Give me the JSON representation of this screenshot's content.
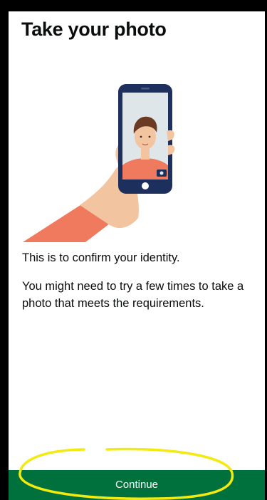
{
  "page": {
    "title": "Take your photo",
    "paragraph_1": "This is to confirm your identity.",
    "paragraph_2": "You might need to try a few times to take a photo that meets the requirements."
  },
  "actions": {
    "continue_label": "Continue"
  },
  "colors": {
    "button_green": "#00703c",
    "annotation_yellow": "#f2ea10",
    "phone_navy": "#1d2f5c",
    "hand_skin": "#f2c4a0",
    "sleeve": "#ef7a5d"
  },
  "illustration": {
    "subject": "hand-holding-phone-selfie"
  }
}
